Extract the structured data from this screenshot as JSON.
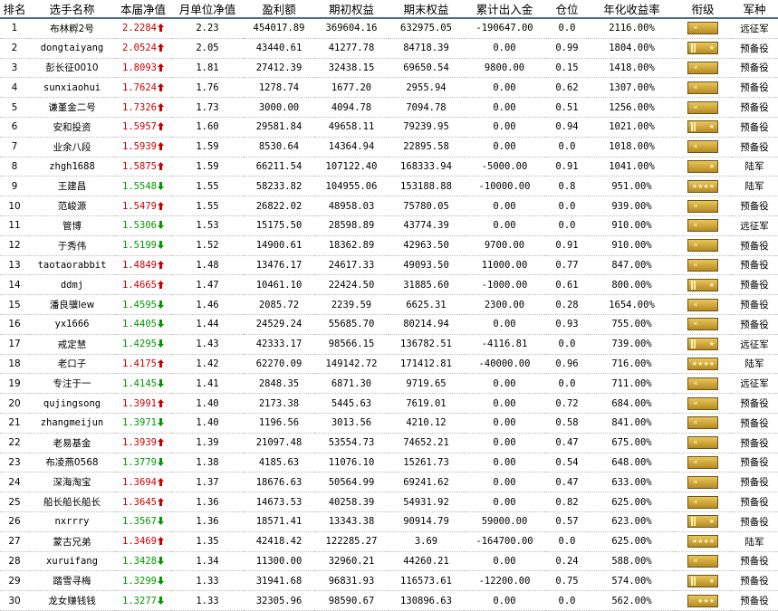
{
  "headers": [
    "排名",
    "选手名称",
    "本届净值",
    "月单位净值",
    "盈利额",
    "期初权益",
    "期末权益",
    "累计出入金",
    "仓位",
    "年化收益率",
    "衔级",
    "军种"
  ],
  "colors": {
    "up": "#cc0000",
    "down": "#009900",
    "header_rule": "#4a6b8a",
    "badge": "#c99a2e"
  },
  "rows": [
    {
      "rank": "1",
      "name": "布林孵2号",
      "nav": "2.2284",
      "trend": "up",
      "monthly": "2.23",
      "profit": "454017.89",
      "start": "369604.16",
      "end": "632975.05",
      "flow": "-190647.00",
      "position": "0.0",
      "annual": "2116.00%",
      "rank_badge": "gold-chevron",
      "branch": "远征军"
    },
    {
      "rank": "2",
      "name": "dongtaiyang",
      "nav": "2.0524",
      "trend": "up",
      "monthly": "2.05",
      "profit": "43440.61",
      "start": "41277.78",
      "end": "84718.39",
      "flow": "0.00",
      "position": "0.99",
      "annual": "1804.00%",
      "rank_badge": "gold-stripe-star",
      "branch": "预备役"
    },
    {
      "rank": "3",
      "name": "彭长征0010",
      "nav": "1.8093",
      "trend": "up",
      "monthly": "1.81",
      "profit": "27412.39",
      "start": "32438.15",
      "end": "69650.54",
      "flow": "9800.00",
      "position": "0.15",
      "annual": "1418.00%",
      "rank_badge": "gold-chevron",
      "branch": "预备役"
    },
    {
      "rank": "4",
      "name": "sunxiaohui",
      "nav": "1.7624",
      "trend": "up",
      "monthly": "1.76",
      "profit": "1278.74",
      "start": "1677.20",
      "end": "2955.94",
      "flow": "0.00",
      "position": "0.62",
      "annual": "1307.00%",
      "rank_badge": "gold-chevron",
      "branch": "预备役"
    },
    {
      "rank": "5",
      "name": "谦堇金二号",
      "nav": "1.7326",
      "trend": "up",
      "monthly": "1.73",
      "profit": "3000.00",
      "start": "4094.78",
      "end": "7094.78",
      "flow": "0.00",
      "position": "0.51",
      "annual": "1256.00%",
      "rank_badge": "gold-chevron",
      "branch": "预备役"
    },
    {
      "rank": "6",
      "name": "安和投资",
      "nav": "1.5957",
      "trend": "up",
      "monthly": "1.60",
      "profit": "29581.84",
      "start": "49658.11",
      "end": "79239.95",
      "flow": "0.00",
      "position": "0.94",
      "annual": "1021.00%",
      "rank_badge": "gold-stripe-star",
      "branch": "预备役"
    },
    {
      "rank": "7",
      "name": "业余八段",
      "nav": "1.5939",
      "trend": "up",
      "monthly": "1.59",
      "profit": "8530.64",
      "start": "14364.94",
      "end": "22895.58",
      "flow": "0.00",
      "position": "0.0",
      "annual": "1018.00%",
      "rank_badge": "gold-chevron",
      "branch": "预备役"
    },
    {
      "rank": "8",
      "name": "zhgh1688",
      "nav": "1.5875",
      "trend": "up",
      "monthly": "1.59",
      "profit": "66211.54",
      "start": "107122.40",
      "end": "168333.94",
      "flow": "-5000.00",
      "position": "0.91",
      "annual": "1041.00%",
      "rank_badge": "gold-star",
      "branch": "陆军"
    },
    {
      "rank": "9",
      "name": "王建昌",
      "nav": "1.5548",
      "trend": "down",
      "monthly": "1.55",
      "profit": "58233.82",
      "start": "104955.06",
      "end": "153188.88",
      "flow": "-10000.00",
      "position": "0.8",
      "annual": "951.00%",
      "rank_badge": "gold-four-star",
      "branch": "陆军"
    },
    {
      "rank": "10",
      "name": "范峻源",
      "nav": "1.5479",
      "trend": "up",
      "monthly": "1.55",
      "profit": "26822.02",
      "start": "48958.03",
      "end": "75780.05",
      "flow": "0.00",
      "position": "0.0",
      "annual": "939.00%",
      "rank_badge": "gold-chevron",
      "branch": "预备役"
    },
    {
      "rank": "11",
      "name": "管博",
      "nav": "1.5306",
      "trend": "down",
      "monthly": "1.53",
      "profit": "15175.50",
      "start": "28598.89",
      "end": "43774.39",
      "flow": "0.00",
      "position": "0.0",
      "annual": "910.00%",
      "rank_badge": "gold-chevron",
      "branch": "远征军"
    },
    {
      "rank": "12",
      "name": "于秀伟",
      "nav": "1.5199",
      "trend": "down",
      "monthly": "1.52",
      "profit": "14900.61",
      "start": "18362.89",
      "end": "42963.50",
      "flow": "9700.00",
      "position": "0.91",
      "annual": "910.00%",
      "rank_badge": "gold-chevron",
      "branch": "预备役"
    },
    {
      "rank": "13",
      "name": "taotaorabbit",
      "nav": "1.4849",
      "trend": "up",
      "monthly": "1.48",
      "profit": "13476.17",
      "start": "24617.33",
      "end": "49093.50",
      "flow": "11000.00",
      "position": "0.77",
      "annual": "847.00%",
      "rank_badge": "gold-chevron",
      "branch": "预备役"
    },
    {
      "rank": "14",
      "name": "ddmj",
      "nav": "1.4665",
      "trend": "up",
      "monthly": "1.47",
      "profit": "10461.10",
      "start": "22424.50",
      "end": "31885.60",
      "flow": "-1000.00",
      "position": "0.61",
      "annual": "800.00%",
      "rank_badge": "gold-stripe-star",
      "branch": "预备役"
    },
    {
      "rank": "15",
      "name": "潘良骥lew",
      "nav": "1.4595",
      "trend": "down",
      "monthly": "1.46",
      "profit": "2085.72",
      "start": "2239.59",
      "end": "6625.31",
      "flow": "2300.00",
      "position": "0.28",
      "annual": "1654.00%",
      "rank_badge": "gold-chevron",
      "branch": "预备役"
    },
    {
      "rank": "16",
      "name": "yx1666",
      "nav": "1.4405",
      "trend": "down",
      "monthly": "1.44",
      "profit": "24529.24",
      "start": "55685.70",
      "end": "80214.94",
      "flow": "0.00",
      "position": "0.93",
      "annual": "755.00%",
      "rank_badge": "gold-chevron",
      "branch": "预备役"
    },
    {
      "rank": "17",
      "name": "戒定慧",
      "nav": "1.4295",
      "trend": "down",
      "monthly": "1.43",
      "profit": "42333.17",
      "start": "98566.15",
      "end": "136782.51",
      "flow": "-4116.81",
      "position": "0.0",
      "annual": "739.00%",
      "rank_badge": "gold-stripe-star",
      "branch": "远征军"
    },
    {
      "rank": "18",
      "name": "老口子",
      "nav": "1.4175",
      "trend": "up",
      "monthly": "1.42",
      "profit": "62270.09",
      "start": "149142.72",
      "end": "171412.81",
      "flow": "-40000.00",
      "position": "0.96",
      "annual": "716.00%",
      "rank_badge": "gold-four-star",
      "branch": "陆军"
    },
    {
      "rank": "19",
      "name": "专注于一",
      "nav": "1.4145",
      "trend": "down",
      "monthly": "1.41",
      "profit": "2848.35",
      "start": "6871.30",
      "end": "9719.65",
      "flow": "0.00",
      "position": "0.0",
      "annual": "711.00%",
      "rank_badge": "gold-chevron",
      "branch": "远征军"
    },
    {
      "rank": "20",
      "name": "qujingsong",
      "nav": "1.3991",
      "trend": "up",
      "monthly": "1.40",
      "profit": "2173.38",
      "start": "5445.63",
      "end": "7619.01",
      "flow": "0.00",
      "position": "0.72",
      "annual": "684.00%",
      "rank_badge": "gold-chevron",
      "branch": "预备役"
    },
    {
      "rank": "21",
      "name": "zhangmeijun",
      "nav": "1.3971",
      "trend": "down",
      "monthly": "1.40",
      "profit": "1196.56",
      "start": "3013.56",
      "end": "4210.12",
      "flow": "0.00",
      "position": "0.58",
      "annual": "841.00%",
      "rank_badge": "gold-chevron",
      "branch": "预备役"
    },
    {
      "rank": "22",
      "name": "老易基金",
      "nav": "1.3939",
      "trend": "up",
      "monthly": "1.39",
      "profit": "21097.48",
      "start": "53554.73",
      "end": "74652.21",
      "flow": "0.00",
      "position": "0.47",
      "annual": "675.00%",
      "rank_badge": "gold-chevron",
      "branch": "预备役"
    },
    {
      "rank": "23",
      "name": "布凌燕0568",
      "nav": "1.3779",
      "trend": "down",
      "monthly": "1.38",
      "profit": "4185.63",
      "start": "11076.10",
      "end": "15261.73",
      "flow": "0.00",
      "position": "0.54",
      "annual": "648.00%",
      "rank_badge": "gold-chevron",
      "branch": "预备役"
    },
    {
      "rank": "24",
      "name": "深海淘宝",
      "nav": "1.3694",
      "trend": "up",
      "monthly": "1.37",
      "profit": "18676.63",
      "start": "50564.99",
      "end": "69241.62",
      "flow": "0.00",
      "position": "0.47",
      "annual": "633.00%",
      "rank_badge": "gold-chevron",
      "branch": "预备役"
    },
    {
      "rank": "25",
      "name": "船长船长船长",
      "nav": "1.3645",
      "trend": "up",
      "monthly": "1.36",
      "profit": "14673.53",
      "start": "40258.39",
      "end": "54931.92",
      "flow": "0.00",
      "position": "0.82",
      "annual": "625.00%",
      "rank_badge": "gold-chevron",
      "branch": "预备役"
    },
    {
      "rank": "26",
      "name": "nxrrry",
      "nav": "1.3567",
      "trend": "down",
      "monthly": "1.36",
      "profit": "18571.41",
      "start": "13343.38",
      "end": "90914.79",
      "flow": "59000.00",
      "position": "0.57",
      "annual": "623.00%",
      "rank_badge": "gold-stripe-star",
      "branch": "预备役"
    },
    {
      "rank": "27",
      "name": "蒙古兄弟",
      "nav": "1.3469",
      "trend": "up",
      "monthly": "1.35",
      "profit": "42418.42",
      "start": "122285.27",
      "end": "3.69",
      "flow": "-164700.00",
      "position": "0.0",
      "annual": "625.00%",
      "rank_badge": "gold-four-star",
      "branch": "陆军"
    },
    {
      "rank": "28",
      "name": "xuruifang",
      "nav": "1.3428",
      "trend": "down",
      "monthly": "1.34",
      "profit": "11300.00",
      "start": "32960.21",
      "end": "44260.21",
      "flow": "0.00",
      "position": "0.24",
      "annual": "588.00%",
      "rank_badge": "gold-chevron",
      "branch": "预备役"
    },
    {
      "rank": "29",
      "name": "踏雪寻梅",
      "nav": "1.3299",
      "trend": "down",
      "monthly": "1.33",
      "profit": "31941.68",
      "start": "96831.93",
      "end": "116573.61",
      "flow": "-12200.00",
      "position": "0.75",
      "annual": "574.00%",
      "rank_badge": "gold-stripe-star",
      "branch": "预备役"
    },
    {
      "rank": "30",
      "name": "龙女赚钱钱",
      "nav": "1.3277",
      "trend": "down",
      "monthly": "1.33",
      "profit": "32305.96",
      "start": "98590.67",
      "end": "130896.63",
      "flow": "0.00",
      "position": "0.0",
      "annual": "562.00%",
      "rank_badge": "gold-three-star",
      "branch": "预备役"
    }
  ]
}
